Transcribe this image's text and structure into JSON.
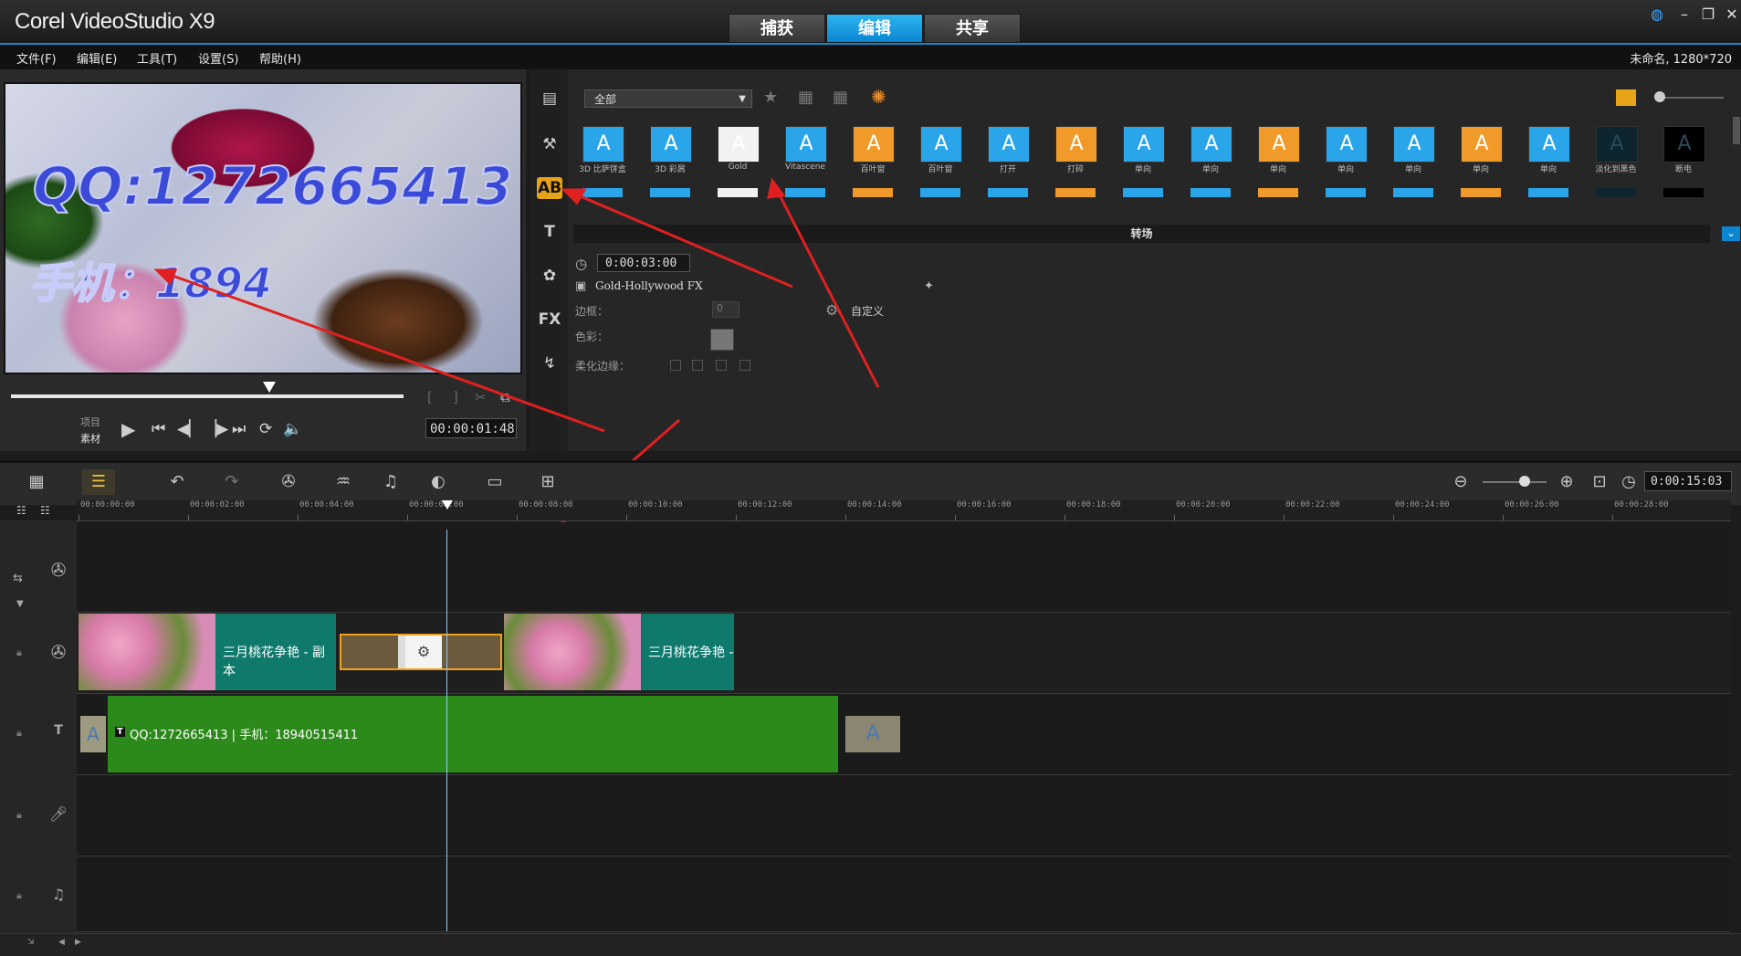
{
  "app": {
    "title": "Corel VideoStudio X9"
  },
  "mode_tabs": [
    {
      "label": "捕获",
      "active": false
    },
    {
      "label": "编辑",
      "active": true
    },
    {
      "label": "共享",
      "active": false
    }
  ],
  "window_buttons": {
    "help": "?",
    "minimize": "–",
    "maximize": "❐",
    "close": "✕"
  },
  "menu": [
    "文件(F)",
    "编辑(E)",
    "工具(T)",
    "设置(S)",
    "帮助(H)"
  ],
  "project_info": "未命名, 1280*720",
  "preview": {
    "overlay_line1": "QQ:1272665413",
    "overlay_line2": "手机：1894",
    "mode_project": "项目",
    "mode_clip": "素材",
    "timecode": "00:00:01:48"
  },
  "library": {
    "category": "全部",
    "transitions": [
      {
        "label": "3D 比萨饼盒",
        "color": "#2aa5ea"
      },
      {
        "label": "3D 彩屑",
        "color": "#2aa5ea"
      },
      {
        "label": "Gold",
        "color": "#f2f2f2"
      },
      {
        "label": "Vitascene",
        "color": "#2aa5ea"
      },
      {
        "label": "百叶窗",
        "color": "#f09a2a"
      },
      {
        "label": "百叶窗",
        "color": "#2aa5ea"
      },
      {
        "label": "打开",
        "color": "#2aa5ea"
      },
      {
        "label": "打碎",
        "color": "#f09a2a"
      },
      {
        "label": "单向",
        "color": "#2aa5ea"
      },
      {
        "label": "单向",
        "color": "#2aa5ea"
      },
      {
        "label": "单向",
        "color": "#f09a2a"
      },
      {
        "label": "单向",
        "color": "#2aa5ea"
      },
      {
        "label": "单向",
        "color": "#2aa5ea"
      },
      {
        "label": "单向",
        "color": "#f09a2a"
      },
      {
        "label": "单向",
        "color": "#2aa5ea"
      },
      {
        "label": "淡化到黑色",
        "color": "#0e2530"
      },
      {
        "label": "断电",
        "color": "#000000"
      }
    ],
    "options_header": "转场",
    "duration": "0:00:03:00",
    "effect_name": "Gold-Hollywood FX",
    "border_label": "边框：",
    "border_value": "0",
    "color_label": "色彩：",
    "soft_edge_label": "柔化边缘：",
    "customize_label": "自定义"
  },
  "timeline": {
    "timecode": "0:00:15:03",
    "ruler_ticks": [
      "00:00:00:00",
      "00:00:02:00",
      "00:00:04:00",
      "00:00:06:00",
      "00:00:08:00",
      "00:00:10:00",
      "00:00:12:00",
      "00:00:14:00",
      "00:00:16:00",
      "00:00:18:00",
      "00:00:20:00",
      "00:00:22:00",
      "00:00:24:00",
      "00:00:26:00",
      "00:00:28:00"
    ],
    "clips": {
      "video1": "三月桃花争艳 - 副本",
      "video2": "三月桃花争艳 -",
      "title": "QQ:1272665413 | 手机：18940515411"
    }
  }
}
